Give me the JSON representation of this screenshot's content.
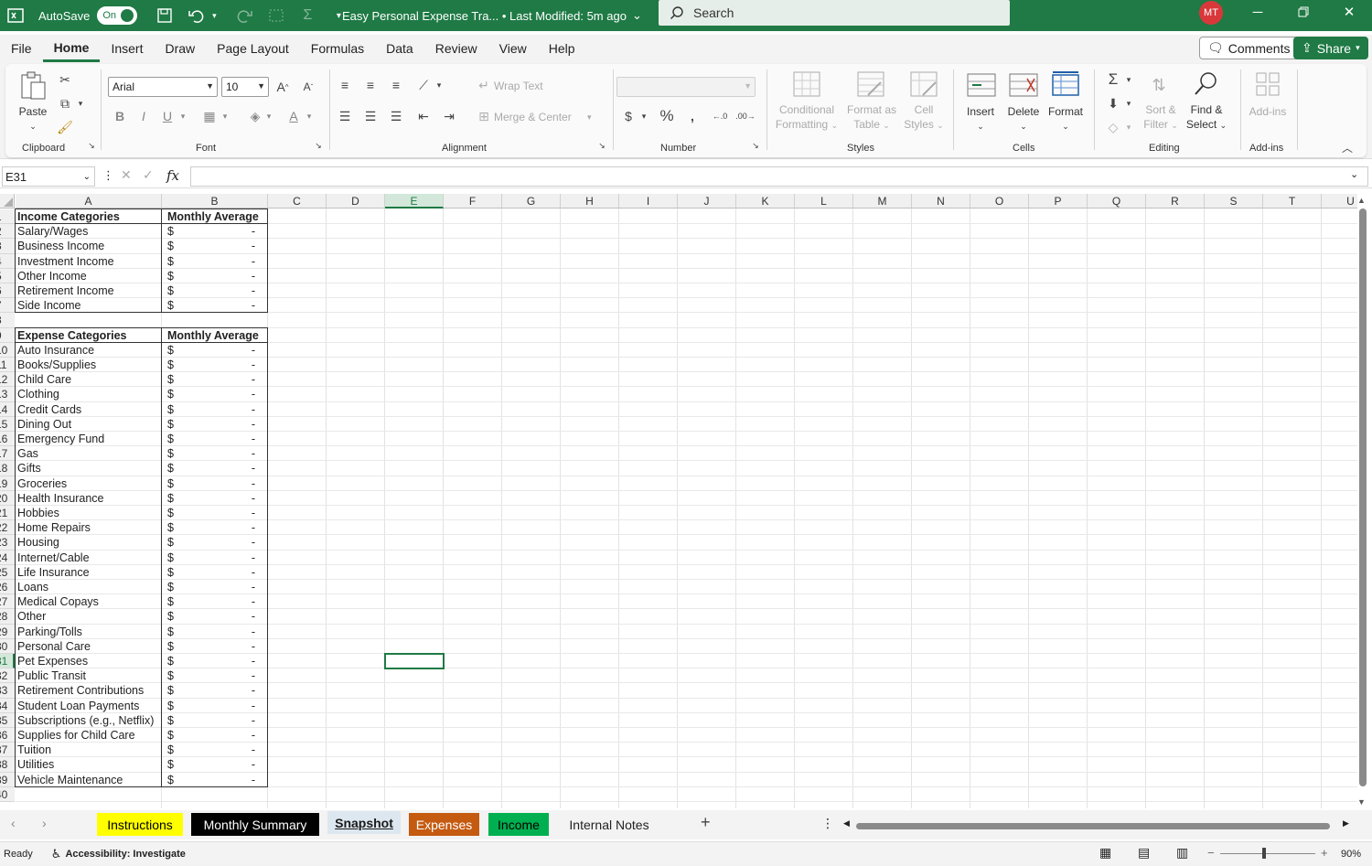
{
  "titlebar": {
    "autosave_label": "AutoSave",
    "autosave_state": "On",
    "document_title": "Easy Personal Expense Tra...  •  Last Modified: 5m ago",
    "search_placeholder": "Search",
    "user_initials": "MT"
  },
  "menu": {
    "tabs": [
      "File",
      "Home",
      "Insert",
      "Draw",
      "Page Layout",
      "Formulas",
      "Data",
      "Review",
      "View",
      "Help"
    ],
    "active": "Home",
    "comments_label": "Comments",
    "share_label": "Share"
  },
  "ribbon": {
    "clipboard": {
      "paste": "Paste",
      "group": "Clipboard"
    },
    "font": {
      "name": "Arial",
      "size": "10",
      "group": "Font"
    },
    "alignment": {
      "wrap": "Wrap Text",
      "merge": "Merge & Center",
      "group": "Alignment"
    },
    "number": {
      "group": "Number"
    },
    "styles": {
      "conditional": [
        "Conditional",
        "Formatting"
      ],
      "format_table": [
        "Format as",
        "Table"
      ],
      "cell_styles": [
        "Cell",
        "Styles"
      ],
      "group": "Styles"
    },
    "cells": {
      "insert": "Insert",
      "delete": "Delete",
      "format": "Format",
      "group": "Cells"
    },
    "editing": {
      "sort": [
        "Sort &",
        "Filter"
      ],
      "find": [
        "Find &",
        "Select"
      ],
      "group": "Editing"
    },
    "addins": {
      "addins": "Add-ins",
      "group": "Add-ins"
    }
  },
  "formula_bar": {
    "name_box": "E31",
    "formula": ""
  },
  "grid": {
    "columns": [
      "A",
      "B",
      "C",
      "D",
      "E",
      "F",
      "G",
      "H",
      "I",
      "J",
      "K",
      "L",
      "M",
      "N",
      "O",
      "P",
      "Q",
      "R",
      "S",
      "T",
      "U"
    ],
    "selected_col": "E",
    "selected_row": 31,
    "rows": [
      [
        "Income Categories",
        "Monthly Average"
      ],
      [
        "Salary/Wages",
        "$",
        "-"
      ],
      [
        "Business Income",
        "$",
        "-"
      ],
      [
        "Investment Income",
        "$",
        "-"
      ],
      [
        "Other Income",
        "$",
        "-"
      ],
      [
        "Retirement Income",
        "$",
        "-"
      ],
      [
        "Side Income",
        "$",
        "-"
      ],
      [],
      [
        "Expense Categories",
        "Monthly Average"
      ],
      [
        "Auto Insurance",
        "$",
        "-"
      ],
      [
        "Books/Supplies",
        "$",
        "-"
      ],
      [
        "Child Care",
        "$",
        "-"
      ],
      [
        "Clothing",
        "$",
        "-"
      ],
      [
        "Credit Cards",
        "$",
        "-"
      ],
      [
        "Dining Out",
        "$",
        "-"
      ],
      [
        "Emergency Fund",
        "$",
        "-"
      ],
      [
        "Gas",
        "$",
        "-"
      ],
      [
        "Gifts",
        "$",
        "-"
      ],
      [
        "Groceries",
        "$",
        "-"
      ],
      [
        "Health Insurance",
        "$",
        "-"
      ],
      [
        "Hobbies",
        "$",
        "-"
      ],
      [
        "Home Repairs",
        "$",
        "-"
      ],
      [
        "Housing",
        "$",
        "-"
      ],
      [
        "Internet/Cable",
        "$",
        "-"
      ],
      [
        "Life Insurance",
        "$",
        "-"
      ],
      [
        "Loans",
        "$",
        "-"
      ],
      [
        "Medical Copays",
        "$",
        "-"
      ],
      [
        "Other",
        "$",
        "-"
      ],
      [
        "Parking/Tolls",
        "$",
        "-"
      ],
      [
        "Personal Care",
        "$",
        "-"
      ],
      [
        "Pet Expenses",
        "$",
        "-"
      ],
      [
        "Public Transit",
        "$",
        "-"
      ],
      [
        "Retirement Contributions",
        "$",
        "-"
      ],
      [
        "Student Loan Payments",
        "$",
        "-"
      ],
      [
        "Subscriptions (e.g., Netflix)",
        "$",
        "-"
      ],
      [
        "Supplies for Child Care",
        "$",
        "-"
      ],
      [
        "Tuition",
        "$",
        "-"
      ],
      [
        "Utilities",
        "$",
        "-"
      ],
      [
        "Vehicle Maintenance",
        "$",
        "-"
      ],
      []
    ]
  },
  "sheet_tabs": [
    {
      "label": "Instructions",
      "bg": "#ffff00",
      "fg": "#000000"
    },
    {
      "label": "Monthly Summary",
      "bg": "#000000",
      "fg": "#ffffff"
    },
    {
      "label": "Snapshot",
      "bg": "#dde7f0",
      "fg": "#1a1a1a",
      "active": true
    },
    {
      "label": "Expenses",
      "bg": "#c55a11",
      "fg": "#ffffff"
    },
    {
      "label": "Income",
      "bg": "#00b050",
      "fg": "#000000"
    },
    {
      "label": "Internal Notes",
      "bg": "#f3f3f3",
      "fg": "#222222"
    }
  ],
  "status": {
    "ready": "Ready",
    "accessibility": "Accessibility: Investigate",
    "zoom": "90%"
  },
  "colors": {
    "accent": "#1f7a45"
  }
}
